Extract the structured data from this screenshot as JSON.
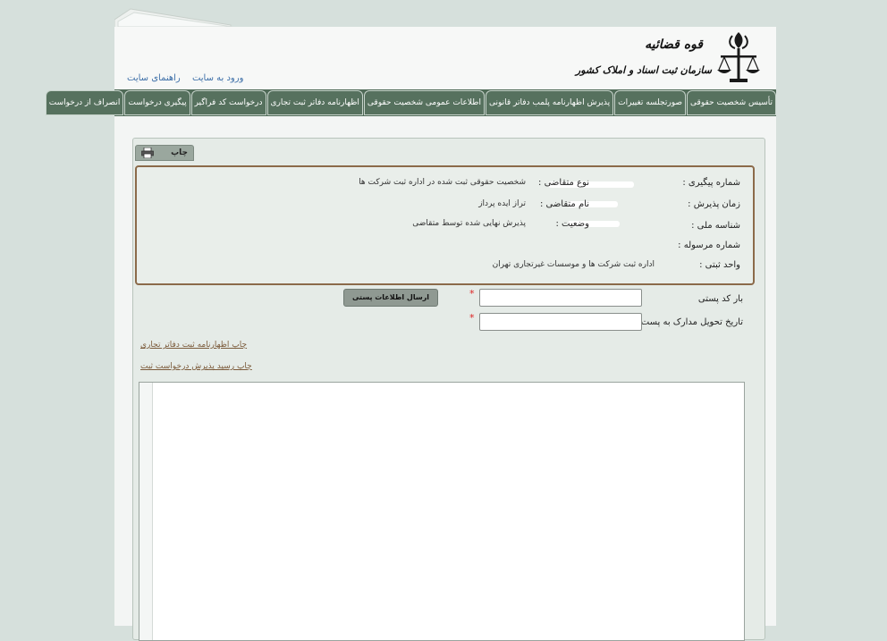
{
  "header": {
    "logo_line1": "قوه قضائیه",
    "logo_line2": "سازمان ثبت اسناد و املاک کشور",
    "links": [
      "ورود به سایت",
      "راهنمای سایت"
    ]
  },
  "nav": [
    "تأسیس شخصیت حقوقی",
    "صورتجلسه تغییرات",
    "پذیرش اظهارنامه پلمب دفاتر قانونی",
    "اطلاعات عمومی شخصیت حقوقی",
    "اظهارنامه دفاتر ثبت تجاری",
    "درخواست کد فراگیر",
    "پیگیری درخواست",
    "انصراف از درخواست"
  ],
  "print_label": "چاپ",
  "info": {
    "rows": [
      {
        "label": "شماره پیگیری :",
        "label2": "نوع متقاضی :",
        "value2": "شخصیت حقوقی ثبت شده در اداره ثبت شرکت ها"
      },
      {
        "label": "زمان پذیرش :",
        "label2": "نام متقاضی :",
        "value2": "تراز ایده پرداز"
      },
      {
        "label": "شناسه ملی :",
        "label2": "وضعیت :",
        "value2": "پذیرش نهایی شده توسط متقاضی"
      },
      {
        "label": "شماره مرسوله :"
      },
      {
        "label": "واحد ثبتی :",
        "value": "اداره ثبت شرکت ها و موسسات غیرتجاری تهران"
      }
    ]
  },
  "form": {
    "postal_code_label": "بار کد پستی",
    "delivery_date_label": "تاریخ تحویل مدارک به پست",
    "send_button": "ارسال اطلاعات پستی",
    "required_mark": "*"
  },
  "links": {
    "print_declaration": "چاپ اظهارنامه ثبت دفاتر تجاری",
    "print_receipt": "چاپ رسید پذیرش درخواست ثبت"
  },
  "colors": {
    "nav_bg": "#4f6a57",
    "page_bg": "#d6e0dc",
    "info_border": "#8b6a4a",
    "link": "#3d6fa8"
  }
}
